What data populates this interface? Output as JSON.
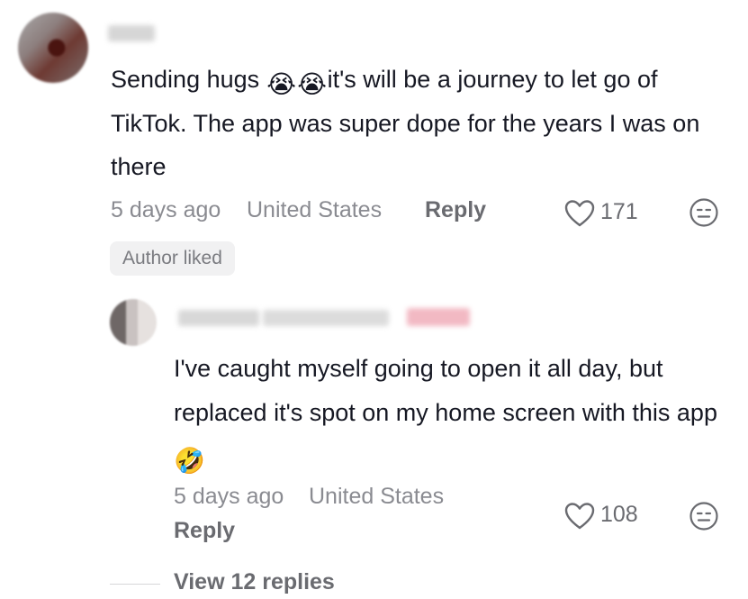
{
  "comment": {
    "text_before_emoji": "Sending hugs ",
    "emoji_1": "😭",
    "emoji_2": "😭",
    "text_after_emoji": "it's will be a journey to let go of TikTok. The app was super dope for the years I was on there",
    "timestamp": "5 days ago",
    "location": "United States",
    "reply_label": "Reply",
    "like_count": "171",
    "author_liked_label": "Author liked"
  },
  "reply": {
    "text": "I've caught myself going to open it all day, but replaced it's spot on my home screen with this app",
    "emoji": "🤣",
    "timestamp": "5 days ago",
    "location": "United States",
    "reply_label": "Reply",
    "like_count": "108"
  },
  "view_replies_label": "View 12 replies",
  "icons": {
    "like": "heart-outline-icon",
    "dislike": "neutral-face-icon"
  },
  "colors": {
    "text": "#161823",
    "meta": "#8a8b91",
    "secondary": "#6a6b70",
    "pill_bg": "#f1f1f2"
  }
}
